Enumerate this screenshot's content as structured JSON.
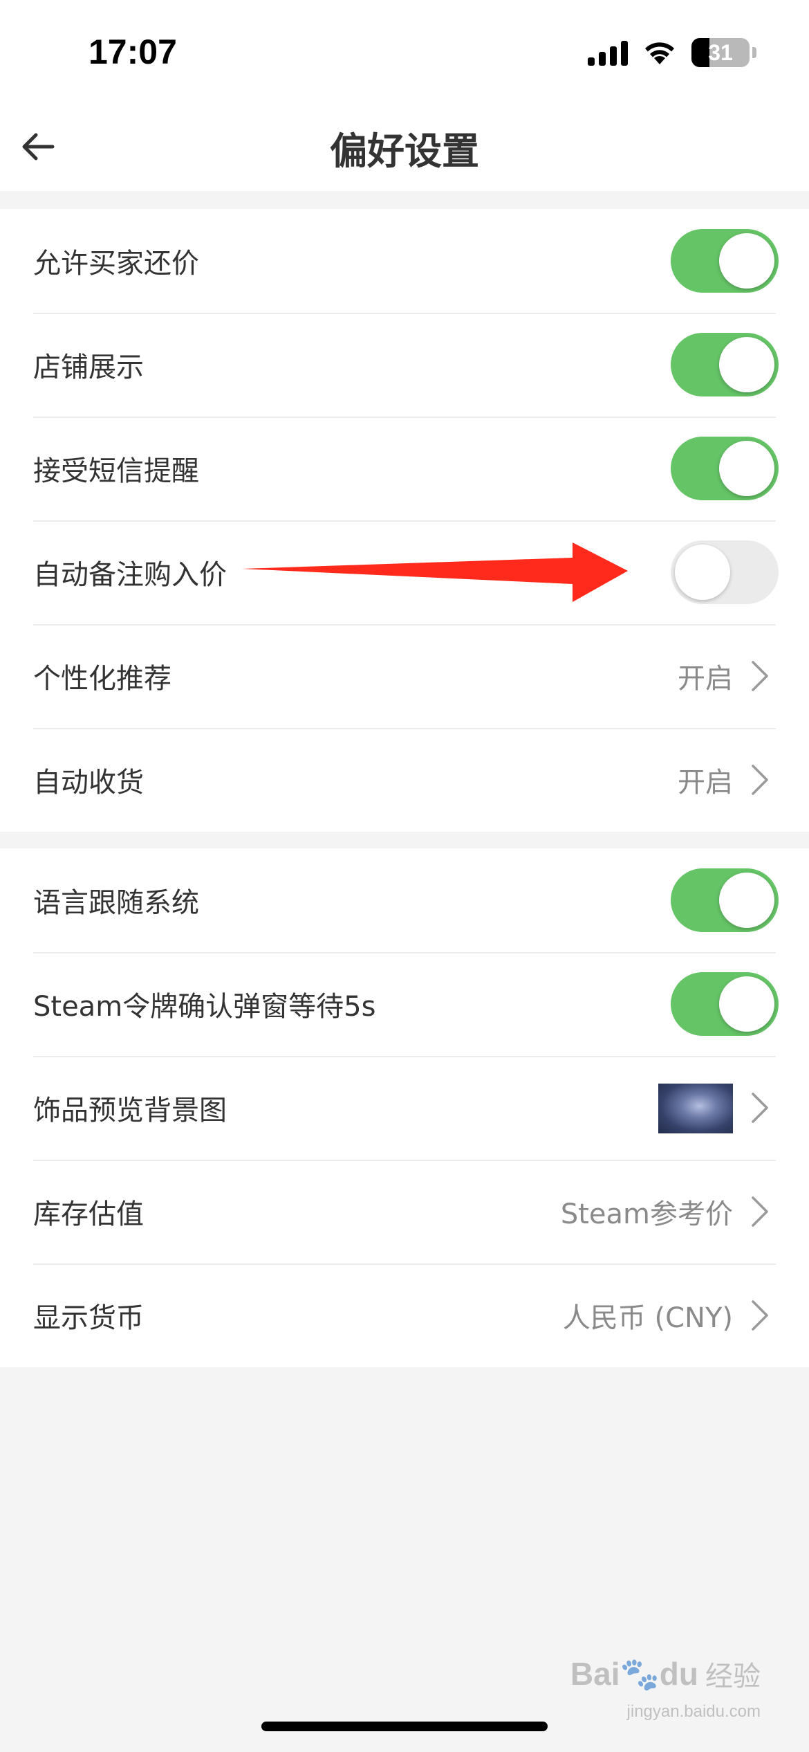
{
  "status_bar": {
    "time": "17:07",
    "battery": "31",
    "battery_level": 0.31,
    "icons": [
      "signal-icon",
      "wifi-icon",
      "battery-icon"
    ]
  },
  "nav": {
    "title": "偏好设置",
    "back_icon": "back-arrow-icon"
  },
  "group1": {
    "rows": [
      {
        "label": "允许买家还价",
        "toggle": true
      },
      {
        "label": "店铺展示",
        "toggle": true
      },
      {
        "label": "接受短信提醒",
        "toggle": true
      },
      {
        "label": "自动备注购入价",
        "toggle": false
      },
      {
        "label": "个性化推荐",
        "value": "开启"
      },
      {
        "label": "自动收货",
        "value": "开启"
      }
    ]
  },
  "group2": {
    "rows": [
      {
        "label": "语言跟随系统",
        "toggle": true
      },
      {
        "label": "Steam令牌确认弹窗等待5s",
        "toggle": true
      },
      {
        "label": "饰品预览背景图",
        "thumbnail": "background-image-thumbnail"
      },
      {
        "label": "库存估值",
        "value": "Steam参考价"
      },
      {
        "label": "显示货币",
        "value": "人民币 (CNY)"
      }
    ]
  },
  "watermark": {
    "logo": "Bai",
    "logo_suffix": "du",
    "text": "经验",
    "url": "jingyan.baidu.com"
  },
  "colors": {
    "toggle_on": "#65c466",
    "toggle_off": "#ebebeb",
    "annotation_arrow": "#ff2a1c",
    "background": "#f4f4f4"
  }
}
